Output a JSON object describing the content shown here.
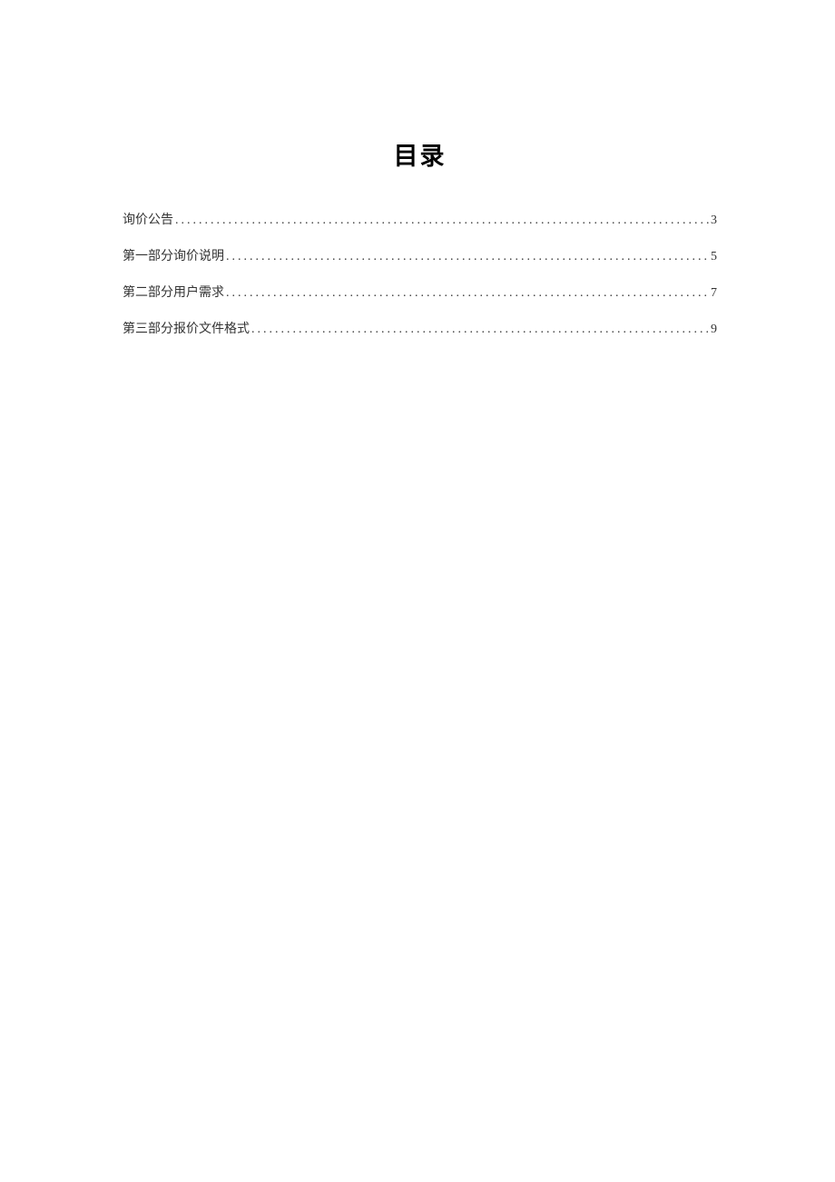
{
  "toc": {
    "title": "目录",
    "entries": [
      {
        "label": "询价公告",
        "page": "3"
      },
      {
        "label": "第一部分询价说明",
        "page": "5"
      },
      {
        "label": "第二部分用户需求",
        "page": "7"
      },
      {
        "label": "第三部分报价文件格式",
        "page": "9"
      }
    ]
  }
}
